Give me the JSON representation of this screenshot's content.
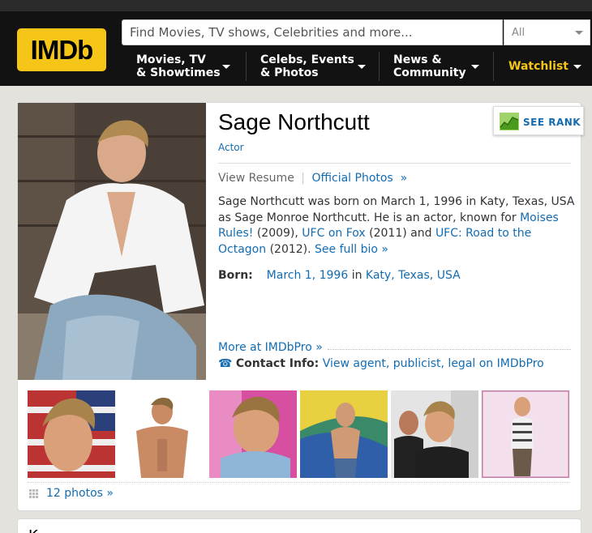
{
  "header": {
    "logo": "IMDb",
    "search": {
      "placeholder": "Find Movies, TV shows, Celebrities and more...",
      "category": "All"
    },
    "nav": [
      {
        "line1": "Movies, TV",
        "line2": "& Showtimes"
      },
      {
        "line1": "Celebs, Events",
        "line2": "& Photos"
      },
      {
        "line1": "News &",
        "line2": "Community"
      },
      {
        "line1": "Watchlist",
        "line2": ""
      }
    ],
    "colors": {
      "brand": "#f5c518",
      "watchlist": "#f5c518",
      "link": "#136cb2"
    }
  },
  "profile": {
    "name": "Sage Northcutt",
    "role": "Actor",
    "see_rank": "SEE RANK",
    "view_resume": "View Resume",
    "separator": "|",
    "official_photos": "Official Photos",
    "bio": {
      "p1": "Sage Northcutt was born on March 1, 1996 in Katy, Texas, USA as Sage Monroe Northcutt. He is an actor, known for",
      "film1": "Moises Rules!",
      "year1": " (2009), ",
      "film2": "UFC on Fox",
      "year2": " (2011) and ",
      "film3": "UFC: Road to the Octagon",
      "year3": " (2012). ",
      "see_full_bio": "See full bio"
    },
    "born": {
      "label": "Born:",
      "date": "March 1, 1996",
      "in": " in ",
      "place": "Katy, Texas, USA"
    },
    "more_at": "More at IMDbPro",
    "contact_label": "Contact Info:",
    "contact_link": "View agent, publicist, legal on IMDbPro"
  },
  "photos": {
    "count_label": "12 photos"
  },
  "next_section_tease": "K"
}
